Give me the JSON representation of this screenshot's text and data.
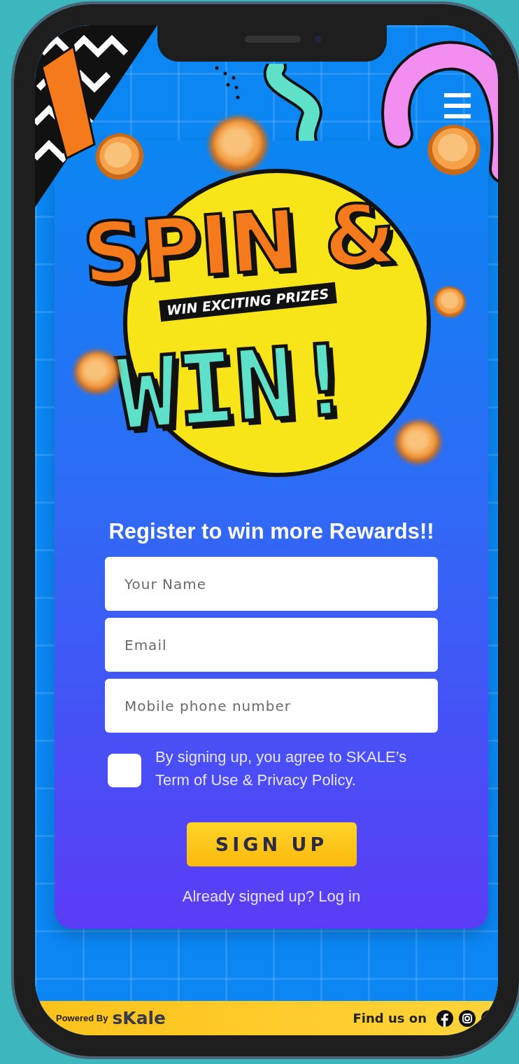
{
  "banner": {
    "title_line_1": "SPIN &",
    "tagline": "WIN EXCITING PRIZES",
    "title_line_2": "WIN!"
  },
  "form": {
    "heading": "Register to win more Rewards!!",
    "fields": [
      {
        "placeholder": "Your Name"
      },
      {
        "placeholder": "Email"
      },
      {
        "placeholder": "Mobile phone number"
      }
    ],
    "consent": {
      "checked": false,
      "text": "By signing up, you agree to SKALE’s Term of Use & Privacy Policy."
    },
    "submit": "SIGN UP",
    "login_prompt": "Already signed up? Log in"
  },
  "footer": {
    "powered_by": "Powered By",
    "brand": "sKale",
    "find_us": "Find us on"
  }
}
